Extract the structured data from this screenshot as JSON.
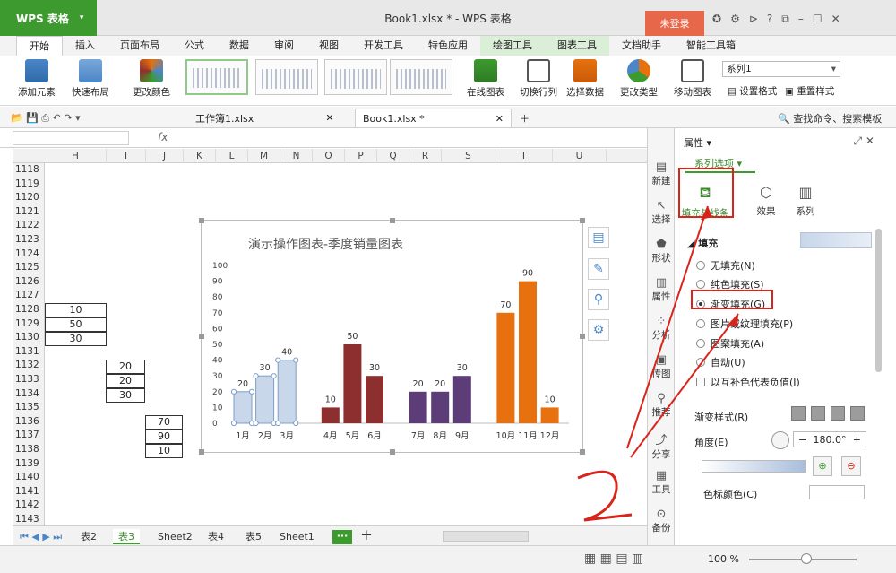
{
  "app": {
    "logo": "WPS 表格",
    "doc_title": "Book1.xlsx * - WPS 表格",
    "login": "未登录"
  },
  "menu": [
    "开始",
    "插入",
    "页面布局",
    "公式",
    "数据",
    "审阅",
    "视图",
    "开发工具",
    "特色应用",
    "绘图工具",
    "图表工具",
    "文档助手",
    "智能工具箱"
  ],
  "ribbon": {
    "add_element": "添加元素",
    "quick_layout": "快速布局",
    "change_color": "更改颜色",
    "online_chart": "在线图表",
    "switch_rowcol": "切换行列",
    "select_data": "选择数据",
    "change_type": "更改类型",
    "move_chart": "移动图表",
    "series_select": "系列1",
    "set_format": "设置格式",
    "reset_style": "重置样式"
  },
  "doc_tabs": [
    "工作簿1.xlsx",
    "Book1.xlsx *"
  ],
  "search_cmd": "查找命令、搜索模板",
  "fx": "fx",
  "columns": [
    "H",
    "I",
    "J",
    "K",
    "L",
    "M",
    "N",
    "O",
    "P",
    "Q",
    "R",
    "S",
    "T",
    "U"
  ],
  "rows": [
    "1118",
    "1119",
    "1120",
    "1121",
    "1122",
    "1123",
    "1124",
    "1125",
    "1126",
    "1127",
    "1128",
    "1129",
    "1130",
    "1131",
    "1132",
    "1133",
    "1134",
    "1135",
    "1136",
    "1137",
    "1138",
    "1139",
    "1140",
    "1141",
    "1142",
    "1143"
  ],
  "cells": {
    "h1128": "10",
    "h1129": "50",
    "h1130": "30",
    "i1132": "20",
    "i1133": "20",
    "i1134": "30",
    "j1136": "70",
    "j1137": "90",
    "j1138": "10"
  },
  "chart_data": {
    "type": "bar",
    "title": "演示操作图表-季度销量图表",
    "categories": [
      "1月",
      "2月",
      "3月",
      "4月",
      "5月",
      "6月",
      "7月",
      "8月",
      "9月",
      "10月",
      "11月",
      "12月"
    ],
    "values": [
      20,
      30,
      40,
      10,
      50,
      30,
      20,
      20,
      30,
      70,
      90,
      10
    ],
    "ylim": [
      0,
      100
    ],
    "yticks": [
      "0",
      "10",
      "20",
      "30",
      "40",
      "50",
      "60",
      "70",
      "80",
      "90",
      "100"
    ],
    "bar_colors": [
      "#c9d7ea",
      "#c9d7ea",
      "#c9d7ea",
      "#8e2f2f",
      "#8e2f2f",
      "#8e2f2f",
      "#5d3d77",
      "#5d3d77",
      "#5d3d77",
      "#e6710e",
      "#e6710e",
      "#e6710e"
    ],
    "grid": false
  },
  "sheets": [
    "表2",
    "表3",
    "Sheet2",
    "表4",
    "表5",
    "Sheet1"
  ],
  "active_sheet": "表3",
  "zoom": "100 %",
  "side_tools": [
    "新建",
    "选择",
    "形状",
    "属性",
    "分析",
    "传图",
    "推荐",
    "分享",
    "工具",
    "备份"
  ],
  "panel": {
    "title": "属性",
    "series_options": "系列选项",
    "tab_fill": "填充与线条",
    "tab_effect": "效果",
    "tab_series": "系列",
    "fill_header": "填充",
    "options": [
      "无填充(N)",
      "纯色填充(S)",
      "渐变填充(G)",
      "图片或纹理填充(P)",
      "图案填充(A)",
      "自动(U)"
    ],
    "invert": "以互补色代表负值(I)",
    "grad_style": "渐变样式(R)",
    "angle_label": "角度(E)",
    "angle_value": "180.0°",
    "stop_color": "色标颜色(C)"
  }
}
